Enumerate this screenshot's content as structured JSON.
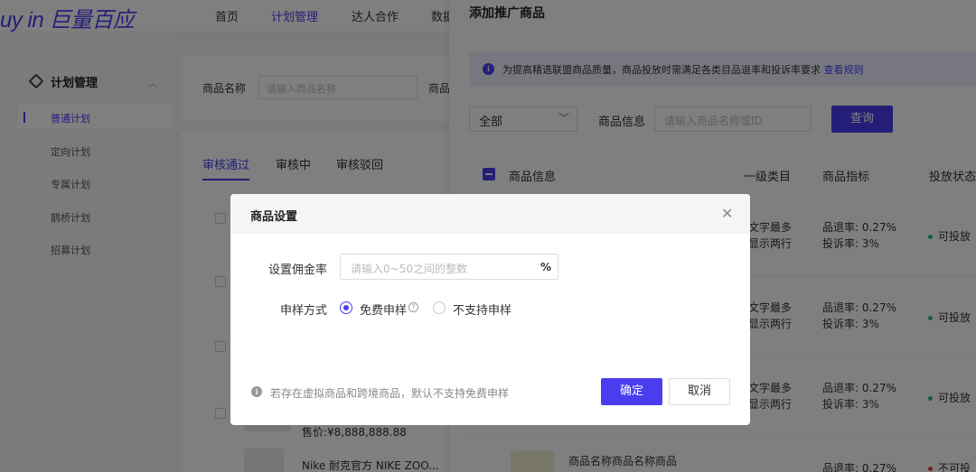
{
  "brand": {
    "logo": "uy in 巨量百应",
    "accent": "#4a3df0"
  },
  "topnav": [
    {
      "label": "首页",
      "active": false
    },
    {
      "label": "计划管理",
      "active": true
    },
    {
      "label": "达人合作",
      "active": false
    },
    {
      "label": "数据",
      "active": false
    }
  ],
  "sidebar": {
    "group": "计划管理",
    "items": [
      {
        "label": "普通计划",
        "active": true
      },
      {
        "label": "定向计划",
        "active": false
      },
      {
        "label": "专属计划",
        "active": false
      },
      {
        "label": "鹊桥计划",
        "active": false
      },
      {
        "label": "招募计划",
        "active": false
      }
    ]
  },
  "main": {
    "filter": {
      "name_label": "商品名称",
      "name_placeholder": "请输入商品名称",
      "next_label": "商品"
    },
    "tabs": [
      {
        "label": "审核通过",
        "active": true
      },
      {
        "label": "审核中",
        "active": false
      },
      {
        "label": "审核驳回",
        "active": false
      }
    ],
    "price": "售价:¥8,888,888.88",
    "product_name": "Nike 耐克官方 NIKE ZOO..."
  },
  "drawer": {
    "title": "添加推广商品",
    "notice": {
      "text": "为提高精选联盟商品质量，商品投放时需满足各类目品退率和投诉率要求",
      "link": "查看规则"
    },
    "select_value": "全部",
    "info_label": "商品信息",
    "search_placeholder": "请输入商品名称或ID",
    "query_button": "查询",
    "columns": [
      "商品信息",
      "一级类目",
      "商品指标",
      "投放状态"
    ],
    "rows": [
      {
        "cat1": "文字最多",
        "cat2": "显示两行",
        "m1": "品退率: 0.27%",
        "m2": "投诉率: 3%",
        "status": "可投放"
      },
      {
        "cat1": "文字最多",
        "cat2": "显示两行",
        "m1": "品退率: 0.27%",
        "m2": "投诉率: 3%",
        "status": "可投放"
      },
      {
        "cat1": "文字最多",
        "cat2": "显示两行",
        "m1": "品退率: 0.27%",
        "m2": "投诉率: 3%",
        "status": "可投放"
      }
    ],
    "last_row": {
      "name": "商品名称商品名称商品",
      "m1": "品退率: 0.27%",
      "status": "不可投"
    },
    "status_colors": {
      "ok": "#2eb872",
      "no": "#e54545"
    }
  },
  "modal": {
    "title": "商品设置",
    "commission_label": "设置佣金率",
    "commission_placeholder": "请输入0~50之间的整数",
    "commission_suffix": "%",
    "sample_label": "申样方式",
    "options": [
      {
        "label": "免费申样",
        "checked": true
      },
      {
        "label": "不支持申样",
        "checked": false
      }
    ],
    "footnote": "若存在虚拟商品和跨境商品，默认不支持免费申样",
    "ok_button": "确定",
    "cancel_button": "取消"
  }
}
